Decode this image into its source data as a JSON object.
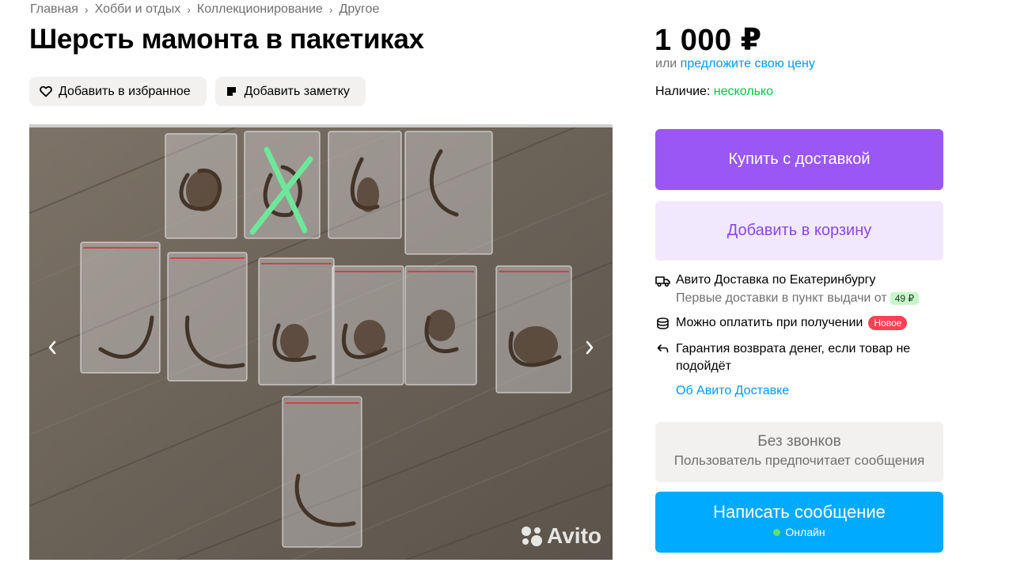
{
  "breadcrumb": [
    "Главная",
    "Хобби и отдых",
    "Коллекционирование",
    "Другое"
  ],
  "title": "Шерсть мамонта в пакетиках",
  "actions": {
    "favorite": "Добавить в избранное",
    "note": "Добавить заметку"
  },
  "gallery": {
    "watermark": "Avito",
    "icons": {
      "prev": "chevron-left-icon",
      "next": "chevron-right-icon"
    }
  },
  "price": {
    "amount": "1 000 ₽",
    "offer_prefix": "или",
    "offer_link": "предложите свою цену"
  },
  "availability": {
    "label": "Наличие:",
    "value": "несколько"
  },
  "buttons": {
    "buy": "Купить с доставкой",
    "cart": "Добавить в корзину"
  },
  "delivery": {
    "title": "Авито Доставка по Екатеринбургу",
    "first_text": "Первые доставки в пункт выдачи от",
    "first_price": "49 ₽",
    "cod": "Можно оплатить при получении",
    "cod_badge": "Новое",
    "guarantee": "Гарантия возврата денег, если товар не подойдёт",
    "about_link": "Об Авито Доставке"
  },
  "contact": {
    "no_calls_title": "Без звонков",
    "no_calls_sub": "Пользователь предпочитает сообщения",
    "message_button": "Написать сообщение",
    "status": "Онлайн"
  },
  "colors": {
    "buy": "#9b57f4",
    "cart_bg": "#f1e8fe",
    "message": "#00aaff",
    "link": "#0099f7",
    "available": "#02c94a",
    "new_badge": "#ff4053"
  }
}
